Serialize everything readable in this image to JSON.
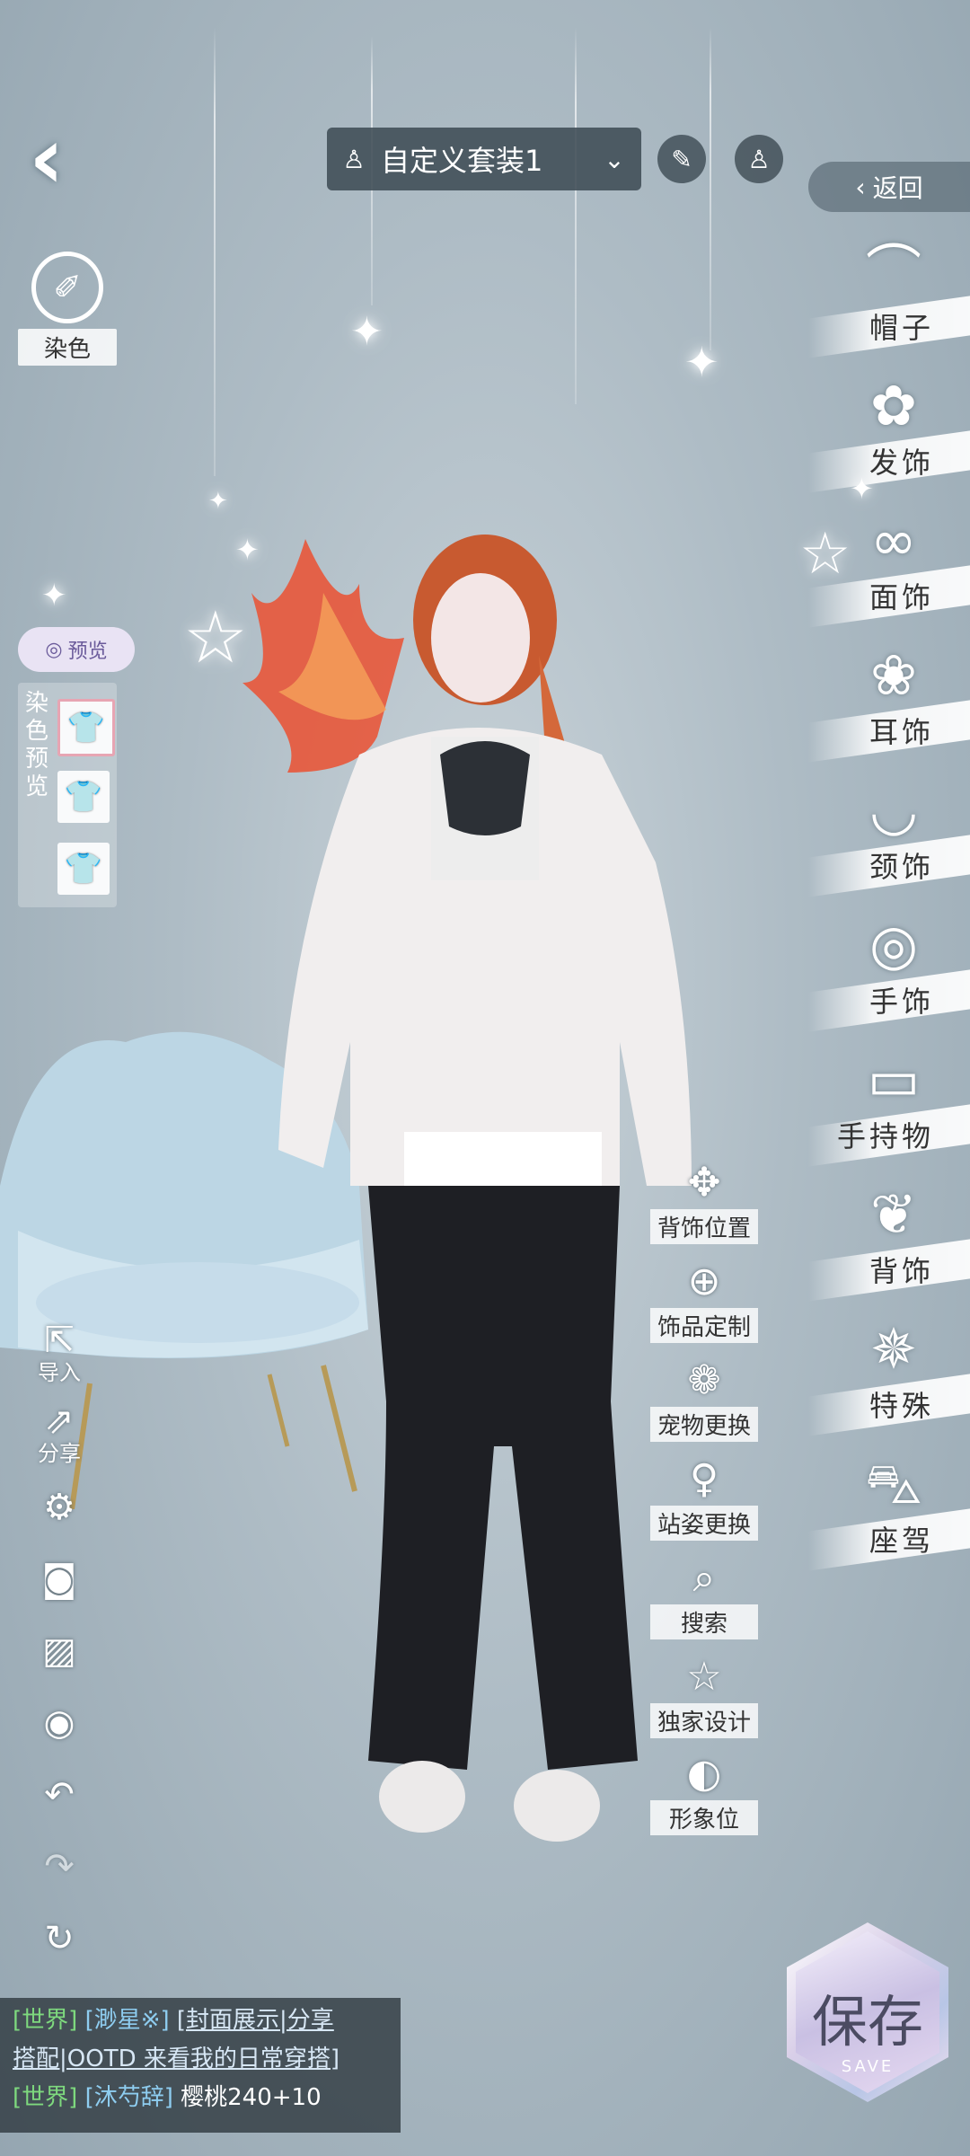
{
  "top_bar": {
    "outfit_name": "自定义套装1",
    "return_label": "返回"
  },
  "left_panel": {
    "dye_label": "染色",
    "preview_label": "预览",
    "dye_preview_label": "染色预览",
    "tools": [
      {
        "label": "导入"
      },
      {
        "label": "分享"
      }
    ]
  },
  "right_categories": [
    {
      "label": "帽子",
      "icon": "hat-icon"
    },
    {
      "label": "发饰",
      "icon": "hairpin-icon"
    },
    {
      "label": "面饰",
      "icon": "face-accessory-icon"
    },
    {
      "label": "耳饰",
      "icon": "earring-icon"
    },
    {
      "label": "颈饰",
      "icon": "necklace-icon"
    },
    {
      "label": "手饰",
      "icon": "bracelet-icon"
    },
    {
      "label": "手持物",
      "icon": "handheld-icon"
    },
    {
      "label": "背饰",
      "icon": "wings-icon"
    },
    {
      "label": "特殊",
      "icon": "special-icon"
    },
    {
      "label": "座驾",
      "icon": "car-icon"
    }
  ],
  "actions": [
    {
      "label": "背饰位置",
      "icon": "move-icon"
    },
    {
      "label": "饰品定制",
      "icon": "bag-icon"
    },
    {
      "label": "宠物更换",
      "icon": "paw-icon"
    },
    {
      "label": "站姿更换",
      "icon": "person-icon"
    },
    {
      "label": "搜索",
      "icon": "search-icon"
    },
    {
      "label": "独家设计",
      "icon": "star-icon"
    },
    {
      "label": "形象位",
      "icon": "portrait-icon"
    }
  ],
  "chat": {
    "line1_tag": "[世界]",
    "line1_name": "[渺星※]",
    "line1_link_a": "[封面展示|分享",
    "line1_link_b": "搭配|OOTD 来看我的日常穿搭]",
    "line2_tag": "[世界]",
    "line2_name": "[沐芍辞]",
    "line2_msg": "樱桃240+10"
  },
  "save": {
    "label": "保存",
    "sub": "SAVE"
  },
  "colors": {
    "accent_chat_tag": "#7ed97e",
    "accent_chat_name": "#8ecdf0",
    "panel_dark": "#3f4c55"
  }
}
